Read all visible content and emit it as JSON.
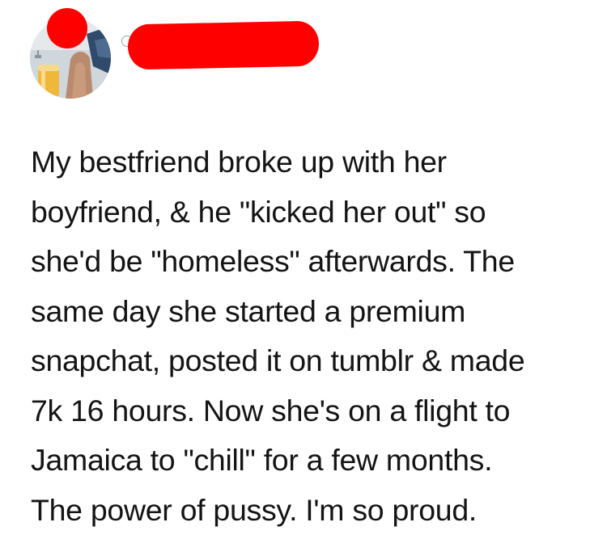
{
  "post": {
    "author": {
      "avatar_icon": "profile-photo",
      "redaction_color": "#ff0000"
    },
    "body_lines": [
      "My bestfriend broke up with her",
      "boyfriend, & he \"kicked her out\" so",
      "she'd be \"homeless\" afterwards. The",
      "same day she started a premium",
      "snapchat, posted it on tumblr & made",
      "7k 16 hours. Now she's on a flight to",
      "Jamaica to \"chill\" for a few months.",
      "The power of pussy. I'm so proud."
    ]
  }
}
